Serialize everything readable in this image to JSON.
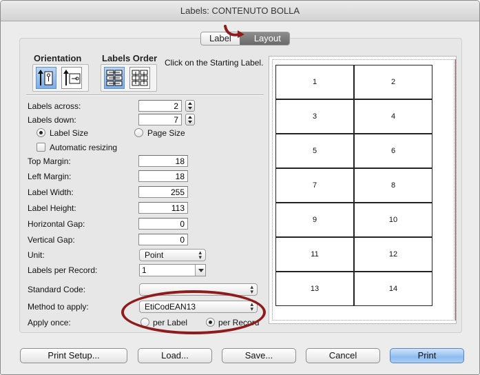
{
  "window": {
    "title": "Labels: CONTENUTO BOLLA"
  },
  "tabs": [
    {
      "label": "Label"
    },
    {
      "label": "Layout"
    }
  ],
  "orientation": {
    "title": "Orientation",
    "options": [
      "portrait-icon",
      "landscape-icon"
    ]
  },
  "labels_order": {
    "title": "Labels Order",
    "options": [
      "row-order-icon",
      "column-order-icon"
    ]
  },
  "hint": "Click on the Starting Label.",
  "form": {
    "labels_across": {
      "label": "Labels across:",
      "value": "2"
    },
    "labels_down": {
      "label": "Labels down:",
      "value": "7"
    },
    "size_mode": {
      "label_size": "Label Size",
      "page_size": "Page Size",
      "selected": "label_size"
    },
    "auto_resize": {
      "label": "Automatic resizing",
      "checked": false
    },
    "top_margin": {
      "label": "Top Margin:",
      "value": "18"
    },
    "left_margin": {
      "label": "Left Margin:",
      "value": "18"
    },
    "label_width": {
      "label": "Label Width:",
      "value": "255"
    },
    "label_height": {
      "label": "Label Height:",
      "value": "113"
    },
    "horizontal_gap": {
      "label": "Horizontal Gap:",
      "value": "0"
    },
    "vertical_gap": {
      "label": "Vertical Gap:",
      "value": "0"
    },
    "unit": {
      "label": "Unit:",
      "value": "Point"
    },
    "labels_per_record": {
      "label": "Labels per Record:",
      "value": "1"
    },
    "standard_code": {
      "label": "Standard Code:",
      "value": ""
    },
    "method": {
      "label": "Method to apply:",
      "value": "EtiCodEAN13"
    },
    "apply_once": {
      "label": "Apply once:",
      "per_label": "per Label",
      "per_record": "per Record",
      "selected": "per_record"
    }
  },
  "preview": {
    "labels": [
      "1",
      "2",
      "3",
      "4",
      "5",
      "6",
      "7",
      "8",
      "9",
      "10",
      "11",
      "12",
      "13",
      "14"
    ]
  },
  "buttons": {
    "print_setup": "Print Setup...",
    "load": "Load...",
    "save": "Save...",
    "cancel": "Cancel",
    "print": "Print"
  },
  "colors": {
    "annotation": "#8e1c1c",
    "default_button": "#8ebcf0",
    "margin_line": "#d23a3a"
  }
}
